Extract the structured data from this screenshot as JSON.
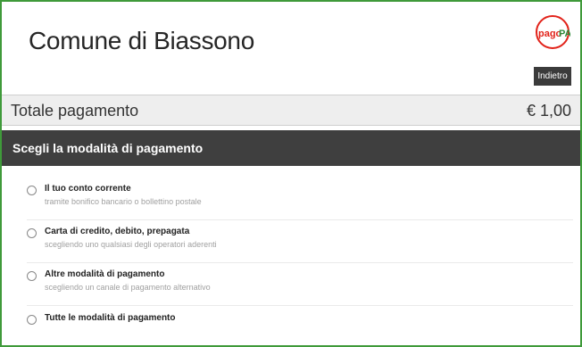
{
  "header": {
    "title": "Comune di Biassono",
    "logo_text": "pagoPA",
    "back_label": "Indietro"
  },
  "total": {
    "label": "Totale pagamento",
    "value": "€ 1,00"
  },
  "section": {
    "title": "Scegli la modalità di pagamento"
  },
  "options": [
    {
      "title": "Il tuo conto corrente",
      "subtitle": "tramite bonifico bancario o bollettino postale"
    },
    {
      "title": "Carta di credito, debito, prepagata",
      "subtitle": "scegliendo uno qualsiasi degli operatori aderenti"
    },
    {
      "title": "Altre modalità di pagamento",
      "subtitle": "scegliendo un canale di pagamento alternativo"
    },
    {
      "title": "Tutte le modalità di pagamento",
      "subtitle": ""
    }
  ],
  "colors": {
    "frame_border": "#3f9a3a",
    "section_header_bg": "#3f3f3f",
    "logo_green": "#2e8b3a",
    "logo_red": "#e2231a"
  }
}
